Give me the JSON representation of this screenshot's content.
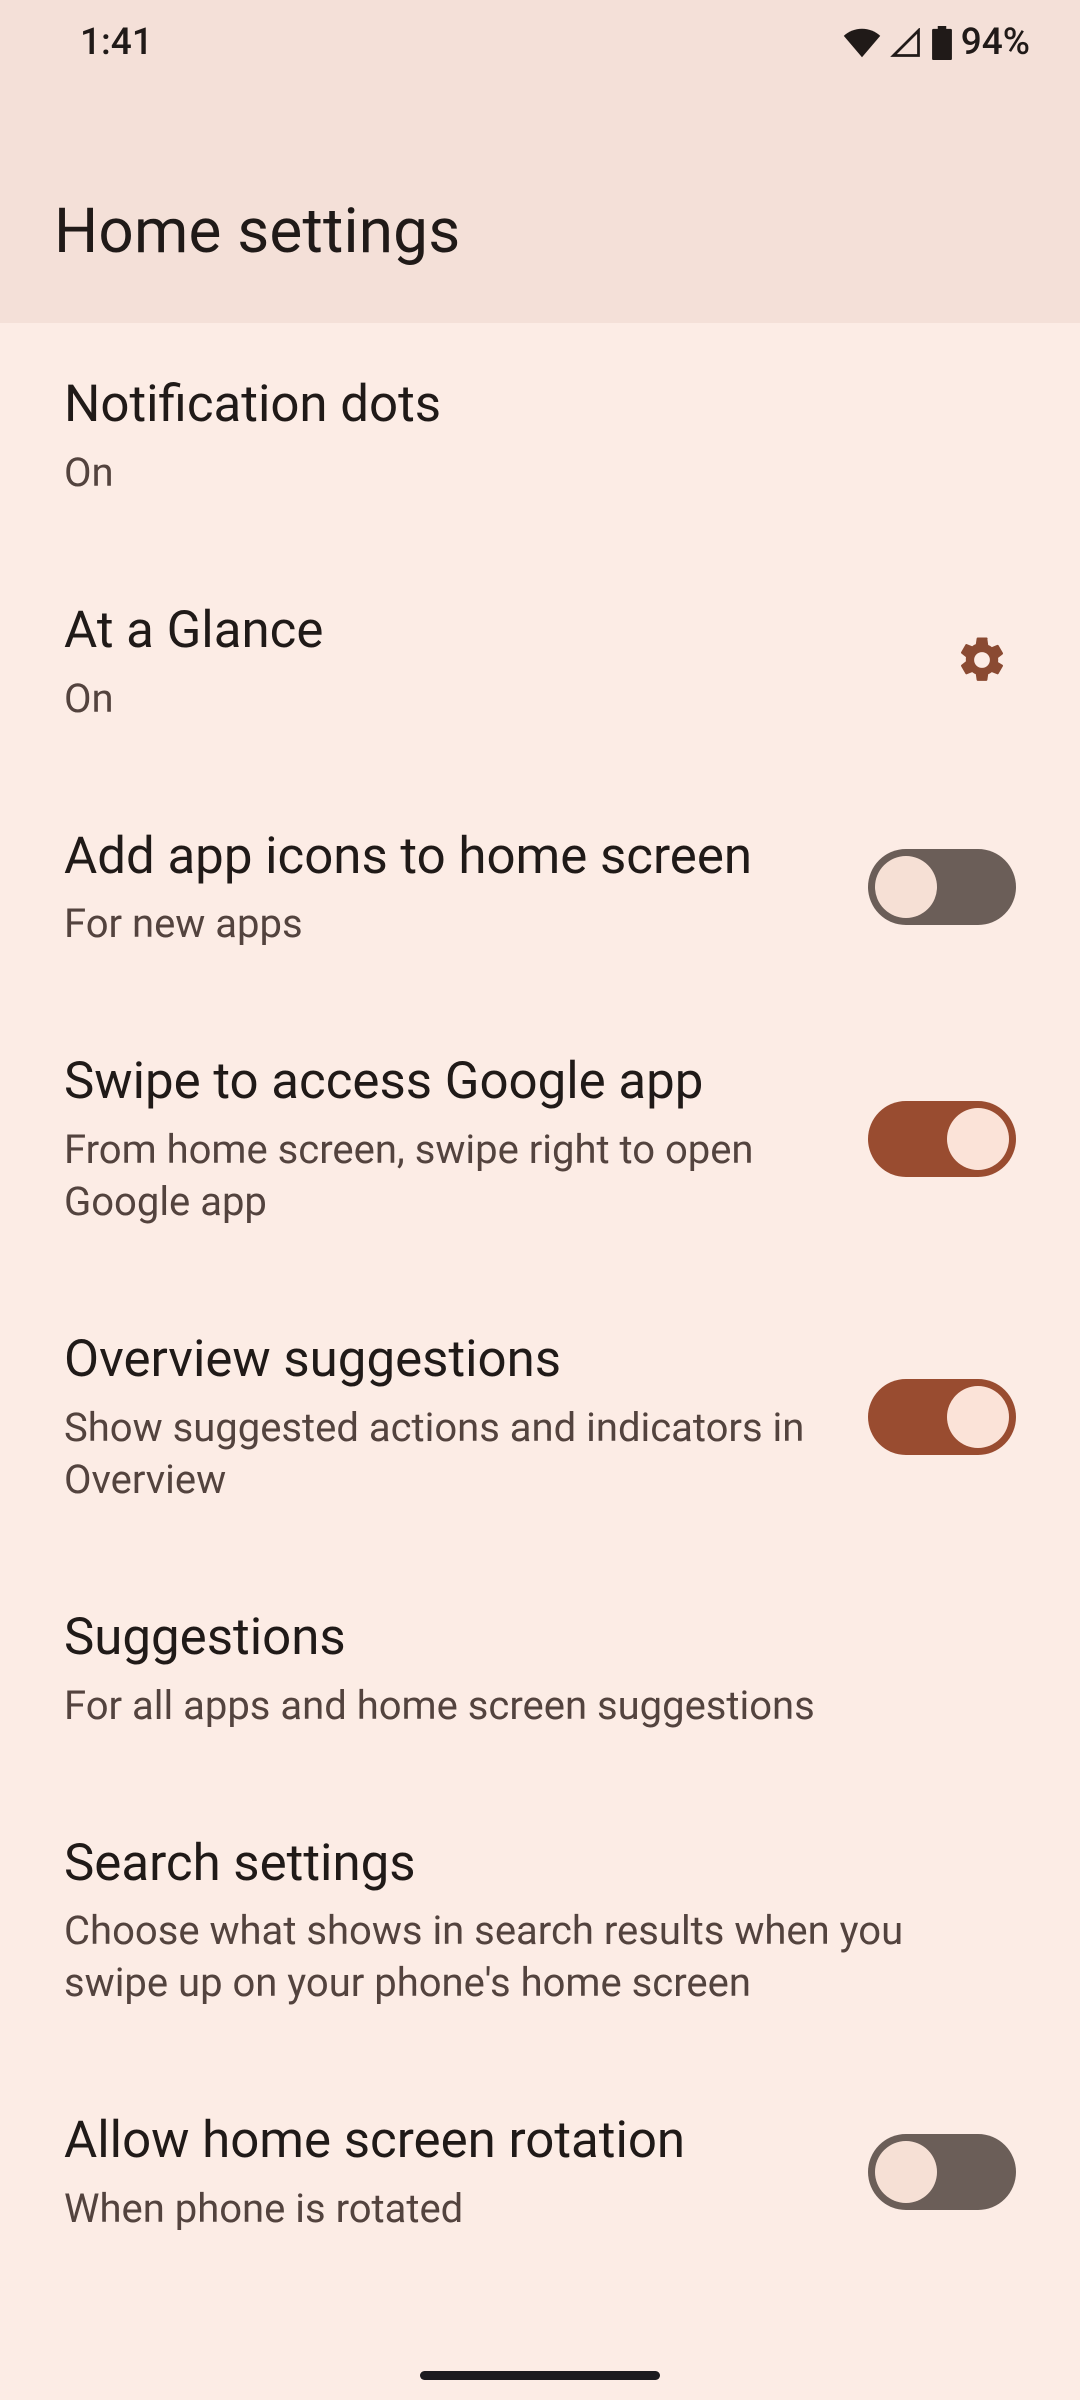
{
  "status": {
    "time": "1:41",
    "battery": "94%"
  },
  "header": {
    "title": "Home settings"
  },
  "items": [
    {
      "title": "Notification dots",
      "sub": "On"
    },
    {
      "title": "At a Glance",
      "sub": "On"
    },
    {
      "title": "Add app icons to home screen",
      "sub": "For new apps"
    },
    {
      "title": "Swipe to access Google app",
      "sub": "From home screen, swipe right to open Google app"
    },
    {
      "title": "Overview suggestions",
      "sub": "Show suggested actions and indicators in Overview"
    },
    {
      "title": "Suggestions",
      "sub": "For all apps and home screen suggestions"
    },
    {
      "title": "Search settings",
      "sub": "Choose what shows in search results when you swipe up on your phone's home screen"
    },
    {
      "title": "Allow home screen rotation",
      "sub": "When phone is rotated"
    }
  ]
}
